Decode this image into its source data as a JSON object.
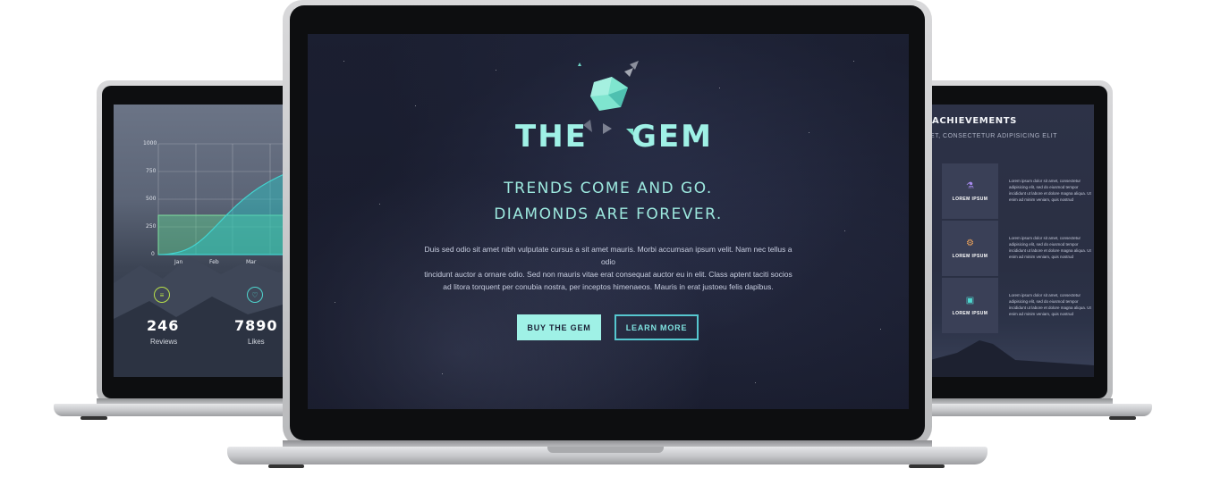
{
  "left_screen": {
    "chart": {
      "y_ticks": [
        "1000",
        "750",
        "500",
        "250",
        "0"
      ],
      "x_ticks": [
        "Jan",
        "Feb",
        "Mar"
      ]
    },
    "stats": [
      {
        "icon": "list-icon",
        "value": "246",
        "label": "Reviews",
        "color": "#b8e04a"
      },
      {
        "icon": "heart-icon",
        "value": "7890",
        "label": "Likes",
        "color": "#4fd6cf"
      }
    ]
  },
  "center_screen": {
    "logo": {
      "left": "THE",
      "right": "GEM",
      "color": "#9ff1e6"
    },
    "tagline_line1": "TRENDS COME AND GO.",
    "tagline_line2": "DIAMONDS ARE FOREVER.",
    "body_line1": "Duis sed odio sit amet nibh vulputate cursus a sit amet mauris. Morbi accumsan ipsum velit. Nam nec tellus a odio",
    "body_line2": "tincidunt auctor a ornare odio. Sed non  mauris vitae erat consequat auctor eu in elit. Class aptent taciti socios",
    "body_line3": "ad litora torquent per conubia nostra, per inceptos himenaeos. Mauris in erat justoeu felis dapibus.",
    "primary_button": "BUY THE GEM",
    "secondary_button": "LEARN MORE"
  },
  "right_screen": {
    "title": "ACHIEVEMENTS",
    "subtitle": "ET, CONSECTETUR ADIPISICING ELIT",
    "items": [
      {
        "icon": "award-icon",
        "label": "LOREM IPSUM",
        "icon_color": "#a98cf2",
        "text": "Lorem ipsum dolor sit amet, consectetur adipisicing elit, sed do eiusmod tempor incididunt ut labore et dolore magna aliqua. Ut enim ad minim veniam, quis nostrud"
      },
      {
        "icon": "gear-icon",
        "label": "LOREM IPSUM",
        "icon_color": "#f0a55a",
        "text": "Lorem ipsum dolor sit amet, consectetur adipisicing elit, sed do eiusmod tempor incididunt ut labore et dolore magna aliqua. Ut enim ad minim veniam, quis nostrud"
      },
      {
        "icon": "monitor-icon",
        "label": "LOREM IPSUM",
        "icon_color": "#4fd6cf",
        "text": "Lorem ipsum dolor sit amet, consectetur adipisicing elit, sed do eiusmod tempor incididunt ut labore et dolore magna aliqua. Ut enim ad minim veniam, quis nostrud"
      }
    ]
  }
}
